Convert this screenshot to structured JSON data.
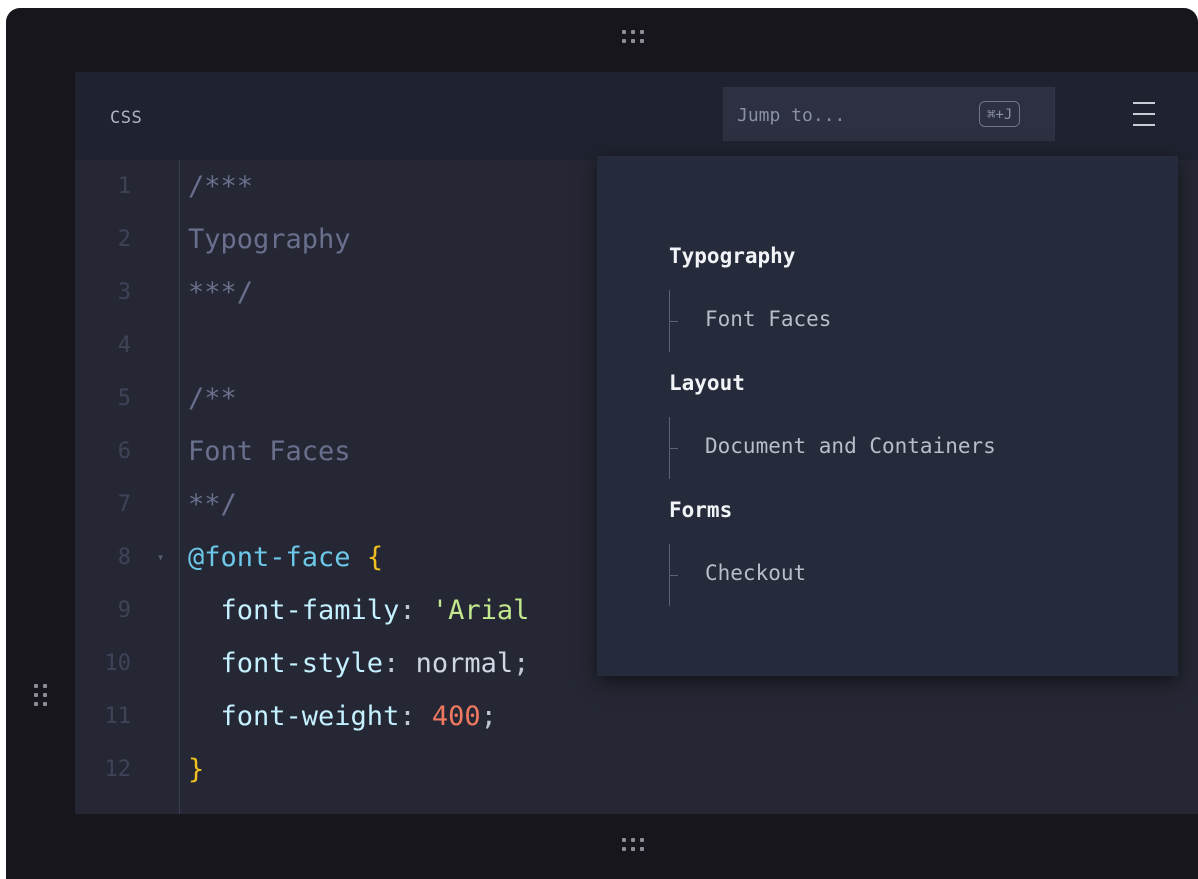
{
  "editor": {
    "language": "CSS",
    "jump": {
      "placeholder": "Jump to...",
      "shortcut": "⌘+J"
    },
    "code_lines": [
      {
        "n": "1",
        "tokens": [
          {
            "t": "/***",
            "c": "comment"
          }
        ]
      },
      {
        "n": "2",
        "tokens": [
          {
            "t": "Typography",
            "c": "comment"
          }
        ]
      },
      {
        "n": "3",
        "tokens": [
          {
            "t": "***/",
            "c": "comment"
          }
        ]
      },
      {
        "n": "4",
        "tokens": []
      },
      {
        "n": "5",
        "tokens": [
          {
            "t": "/**",
            "c": "comment"
          }
        ]
      },
      {
        "n": "6",
        "tokens": [
          {
            "t": "Font Faces",
            "c": "comment"
          }
        ]
      },
      {
        "n": "7",
        "tokens": [
          {
            "t": "**/",
            "c": "comment"
          }
        ]
      },
      {
        "n": "8",
        "fold": true,
        "tokens": [
          {
            "t": "@font-face",
            "c": "at"
          },
          {
            "t": " ",
            "c": "punc"
          },
          {
            "t": "{",
            "c": "brace"
          }
        ]
      },
      {
        "n": "9",
        "tokens": [
          {
            "t": "  font-family",
            "c": "prop"
          },
          {
            "t": ": ",
            "c": "punc"
          },
          {
            "t": "'Arial",
            "c": "str"
          }
        ]
      },
      {
        "n": "10",
        "tokens": [
          {
            "t": "  font-style",
            "c": "prop"
          },
          {
            "t": ": ",
            "c": "punc"
          },
          {
            "t": "normal",
            "c": "val"
          },
          {
            "t": ";",
            "c": "punc"
          }
        ]
      },
      {
        "n": "11",
        "tokens": [
          {
            "t": "  font-weight",
            "c": "prop"
          },
          {
            "t": ": ",
            "c": "punc"
          },
          {
            "t": "400",
            "c": "num"
          },
          {
            "t": ";",
            "c": "punc"
          }
        ]
      },
      {
        "n": "12",
        "tokens": [
          {
            "t": "}",
            "c": "brace"
          }
        ]
      }
    ]
  },
  "outline": {
    "sections": [
      {
        "title": "Typography",
        "items": [
          "Font Faces"
        ]
      },
      {
        "title": "Layout",
        "items": [
          "Document and Containers"
        ]
      },
      {
        "title": "Forms",
        "items": [
          "Checkout"
        ]
      }
    ]
  },
  "colors": {
    "background": "#17161c",
    "editor_bg": "#252834",
    "panel_bg": "#252b3a",
    "comment": "#696f8d",
    "at_rule": "#6cc7e8",
    "brace": "#f0c020",
    "string": "#c3e88d",
    "number": "#f07860"
  },
  "icons": [
    "drag-handle-icon",
    "hamburger-menu-icon",
    "fold-arrow-icon"
  ]
}
